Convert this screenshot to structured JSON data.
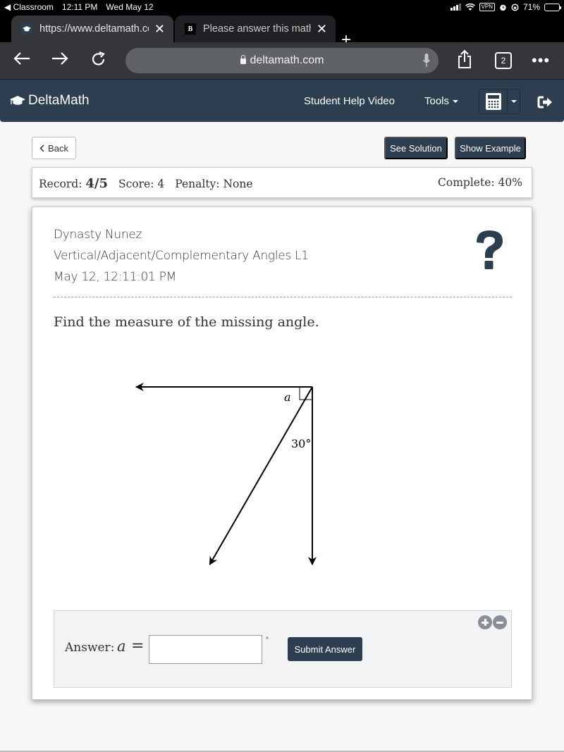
{
  "status_bar": {
    "back_app": "◀ Classroom",
    "time": "12:11 PM",
    "date": "Wed May 12",
    "vpn": "VPN",
    "battery_text": "71%",
    "battery_level": 0.71
  },
  "browser": {
    "tabs": [
      {
        "title": "https://www.deltamath.com",
        "favicon": "deltamath-cap-icon",
        "active": true
      },
      {
        "title": "Please answer this math question",
        "favicon": "brainly-b-icon",
        "active": false
      }
    ],
    "new_tab": "+",
    "url": "deltamath.com",
    "tab_count": "2",
    "more": "•••"
  },
  "nav": {
    "brand": "DeltaMath",
    "help_video": "Student Help Video",
    "tools": "Tools"
  },
  "actions": {
    "back": "Back",
    "see_solution": "See Solution",
    "show_example": "Show Example"
  },
  "record": {
    "record_label": "Record:",
    "record_value": "4/5",
    "score_label": "Score:",
    "score_value": "4",
    "penalty_label": "Penalty:",
    "penalty_value": "None",
    "complete_label": "Complete:",
    "complete_value": "40%"
  },
  "problem": {
    "student": "Dynasty Nunez",
    "skill": "Vertical/Adjacent/Complementary Angles L1",
    "timestamp": "May 12, 12:11:01 PM",
    "prompt": "Find the measure of the missing angle.",
    "diagram": {
      "unknown_label": "a",
      "known_angle_label": "30°",
      "known_angle_degrees": 30,
      "right_angle_marked": true
    }
  },
  "answer": {
    "label": "Answer:",
    "variable": "a",
    "equals": "=",
    "value": "",
    "unit": "°",
    "submit": "Submit Answer"
  },
  "colors": {
    "brand_navy": "#2d3e50",
    "page_bg": "#f7f7f7",
    "answer_bg": "#f2f3f5"
  }
}
